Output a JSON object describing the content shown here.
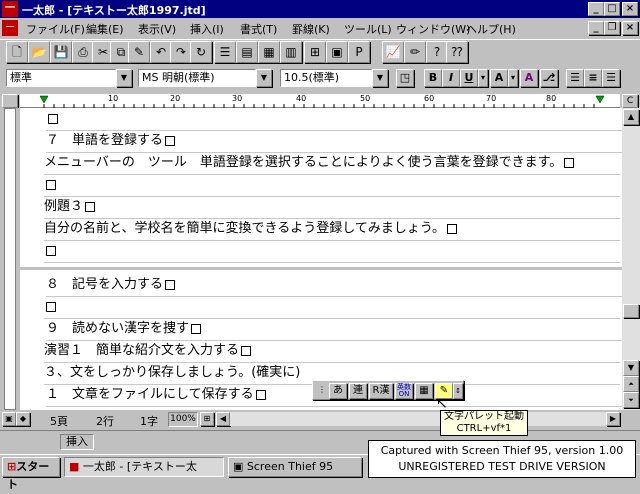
{
  "window": {
    "title": "一太郎 - [テキストー太郎1997.jtd]",
    "icon": "ichitaro-app-icon"
  },
  "menu": [
    "ファイル(F)",
    "編集(E)",
    "表示(V)",
    "挿入(I)",
    "書式(T)",
    "罫線(K)",
    "ツール(L)",
    "ウィンドウ(W)",
    "ヘルプ(H)"
  ],
  "format": {
    "style": "標準",
    "font": "MS 明朝(標準)",
    "size": "10.5(標準)"
  },
  "ruler": {
    "ticks": [
      "10",
      "20",
      "30",
      "40",
      "50",
      "60",
      "70",
      "80"
    ],
    "right_label": "C"
  },
  "document": {
    "lines": [
      "",
      "７　単語を登録する",
      "メニューバーの　ツール　単語登録を選択することによりよく使う言葉を登録できます。",
      "",
      "例題３",
      "自分の名前と、学校名を簡単に変換できるよう登録してみましょう。",
      "",
      "",
      "８　記号を入力する",
      "",
      "９　読めない漢字を捜す",
      "演習１　簡単な紹介文を入力する",
      "３、文をしっかり保存しましょう。(確実に)",
      "１　文章をファイルにして保存する"
    ]
  },
  "palette": {
    "buttons": [
      "あ",
      "連",
      "R漢",
      "英数ON",
      "▦",
      "✎"
    ]
  },
  "tooltip": {
    "title": "文字パレット起動",
    "shortcut": "CTRL+vf*1"
  },
  "status": {
    "page": "5頁",
    "line": "2行",
    "col": "1字",
    "zoom": "100%",
    "mode": "挿入"
  },
  "taskbar": {
    "start": "スタート",
    "tasks": [
      "一太郎 - [テキストー太",
      "Screen Thief 95"
    ]
  },
  "capture": {
    "line1": "Captured with Screen Thief 95, version 1.00",
    "line2": "UNREGISTERED TEST DRIVE VERSION"
  }
}
